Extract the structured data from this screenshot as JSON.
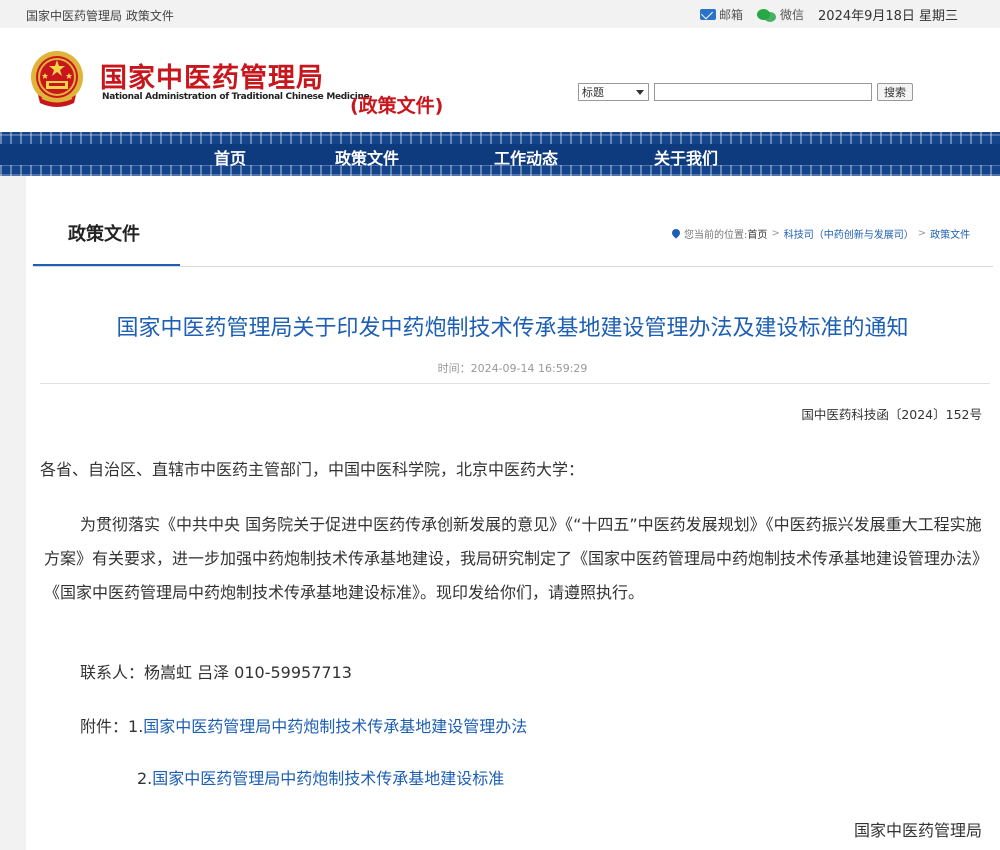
{
  "topbar": {
    "site_label": "国家中医药管理局 政策文件",
    "mail_label": "邮箱",
    "wechat_label": "微信",
    "date_text": "2024年9月18日 星期三"
  },
  "header": {
    "brand_cn": "国家中医药管理局",
    "brand_en": "National Administration of Traditional Chinese Medicine",
    "section_label": "(政策文件)",
    "search": {
      "select_value": "标题",
      "input_value": "",
      "button_label": "搜索"
    }
  },
  "nav": {
    "items": [
      {
        "label": "首页"
      },
      {
        "label": "政策文件"
      },
      {
        "label": "工作动态"
      },
      {
        "label": "关于我们"
      }
    ]
  },
  "column": {
    "title": "政策文件"
  },
  "breadcrumb": {
    "prefix": "您当前的位置:",
    "items": [
      "首页",
      "科技司（中药创新与发展司）",
      "政策文件"
    ]
  },
  "article": {
    "title": "国家中医药管理局关于印发中药炮制技术传承基地建设管理办法及建设标准的通知",
    "time": "时间：2024-09-14 16:59:29",
    "doc_number": "国中医药科技函〔2024〕152号",
    "salutation": "各省、自治区、直辖市中医药主管部门，中国中医科学院，北京中医药大学：",
    "body": "为贯彻落实《中共中央 国务院关于促进中医药传承创新发展的意见》《“十四五”中医药发展规划》《中医药振兴发展重大工程实施方案》有关要求，进一步加强中药炮制技术传承基地建设，我局研究制定了《国家中医药管理局中药炮制技术传承基地建设管理办法》《国家中医药管理局中药炮制技术传承基地建设标准》。现印发给你们，请遵照执行。",
    "contact": "联系人：杨嵩虹 吕泽 010-59957713",
    "attachments_label": "附件：",
    "attachments": [
      {
        "index": "1.",
        "title": "国家中医药管理局中药炮制技术传承基地建设管理办法"
      },
      {
        "index": "2.",
        "title": "国家中医药管理局中药炮制技术传承基地建设标准"
      }
    ],
    "signature": "国家中医药管理局"
  },
  "colors": {
    "brand_red": "#c8161d",
    "nav_blue": "#14448c",
    "link_blue": "#1d5fb3"
  }
}
